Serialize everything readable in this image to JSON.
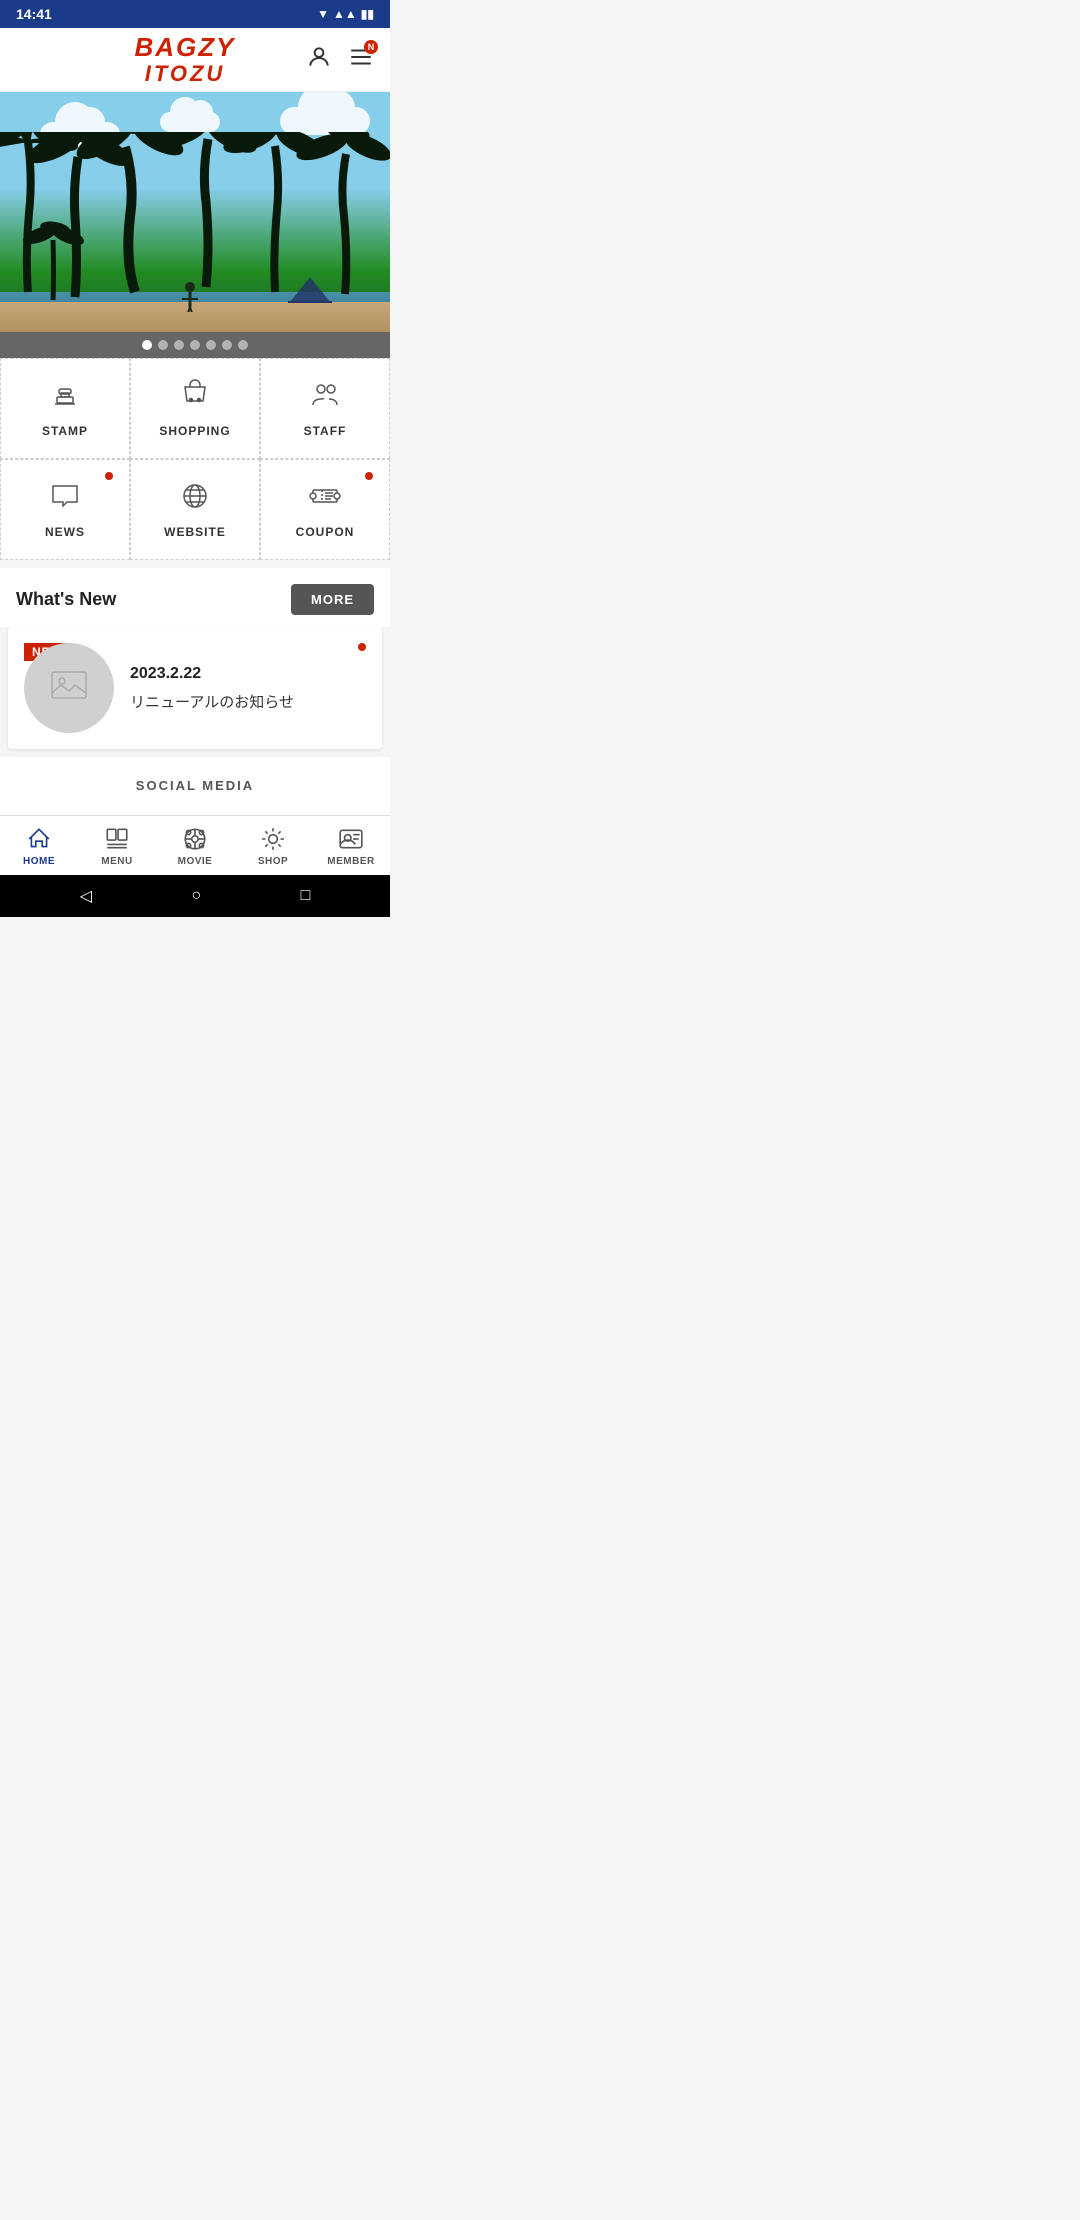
{
  "status_bar": {
    "time": "14:41"
  },
  "header": {
    "logo_line1": "BAGZY",
    "logo_line2": "ITOZU",
    "menu_badge": "N"
  },
  "slider": {
    "dots": [
      true,
      false,
      false,
      false,
      false,
      false,
      false
    ],
    "dot_count": 7
  },
  "grid_menu": {
    "items": [
      {
        "id": "stamp",
        "label": "STAMP",
        "has_dot": false
      },
      {
        "id": "shopping",
        "label": "SHOPPING",
        "has_dot": false
      },
      {
        "id": "staff",
        "label": "STAFF",
        "has_dot": false
      },
      {
        "id": "news",
        "label": "NEWS",
        "has_dot": true
      },
      {
        "id": "website",
        "label": "WEBSITE",
        "has_dot": false
      },
      {
        "id": "coupon",
        "label": "COUPON",
        "has_dot": true
      }
    ]
  },
  "whats_new": {
    "title": "What's New",
    "more_button": "MORE"
  },
  "news_card": {
    "badge": "NEW",
    "date": "2023.2.22",
    "text": "リニューアルのお知らせ",
    "has_dot": true
  },
  "social_media": {
    "title": "SOCIAL MEDIA"
  },
  "bottom_nav": {
    "items": [
      {
        "id": "home",
        "label": "HOME",
        "active": true
      },
      {
        "id": "menu",
        "label": "MENU",
        "active": false
      },
      {
        "id": "movie",
        "label": "MOVIE",
        "active": false
      },
      {
        "id": "shop",
        "label": "SHOP",
        "active": false
      },
      {
        "id": "member",
        "label": "MEMBER",
        "active": false
      }
    ]
  }
}
